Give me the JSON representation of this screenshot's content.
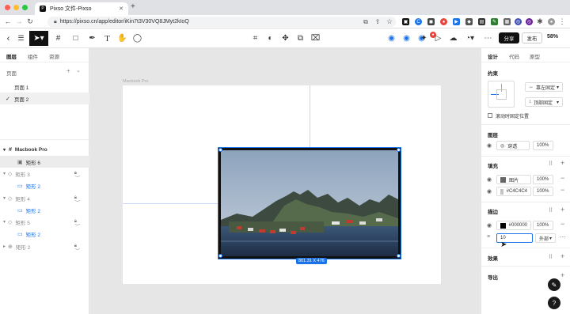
{
  "browser": {
    "tab_title": "Pixso 文件-Pixso",
    "url": "https://pixso.cn/app/editor/iKin7t3V30VQ8JMyt2kIoQ",
    "new_tab": "+"
  },
  "toolbar": {
    "share_label": "分享",
    "publish_label": "发布",
    "zoom": "58%"
  },
  "left_panel": {
    "tabs": [
      "图层",
      "组件",
      "资源"
    ],
    "pages_title": "页面",
    "pages": [
      "页面 1",
      "页面 2"
    ],
    "layers": [
      {
        "label": "Macbook Pro",
        "level": 0
      },
      {
        "label": "矩形 6",
        "level": 1
      },
      {
        "label": "矩形 3",
        "level": 0
      },
      {
        "label": "矩形 2",
        "level": 1
      },
      {
        "label": "矩形 4",
        "level": 0
      },
      {
        "label": "矩形 2",
        "level": 1
      },
      {
        "label": "矩形 5",
        "level": 0
      },
      {
        "label": "矩形 2",
        "level": 1
      },
      {
        "label": "矩形 2",
        "level": 0
      }
    ]
  },
  "canvas": {
    "frame_label": "Macbook Pro",
    "size_badge": "801.31 X 476"
  },
  "right_panel": {
    "tabs": [
      "设计",
      "代码",
      "原型"
    ],
    "constraints_title": "约束",
    "constraint_h": "靠左固定",
    "constraint_v": "顶部固定",
    "scroll_fixed_label": "滚动时固定位置",
    "layer_title": "图层",
    "blend_mode": "穿透",
    "layer_opacity": "100%",
    "fill_title": "填充",
    "fill_image_label": "图片",
    "fill_image_opacity": "100%",
    "fill_color_value": "#C4C4C4",
    "fill_color_opacity": "100%",
    "stroke_title": "描边",
    "stroke_color_value": "#000000",
    "stroke_opacity": "100%",
    "stroke_width": "10",
    "stroke_position": "外部",
    "effects_title": "效果",
    "export_title": "导出",
    "colors": {
      "fill_color": "#C4C4C4",
      "stroke_color": "#000000",
      "accent": "#1a73e8"
    }
  }
}
